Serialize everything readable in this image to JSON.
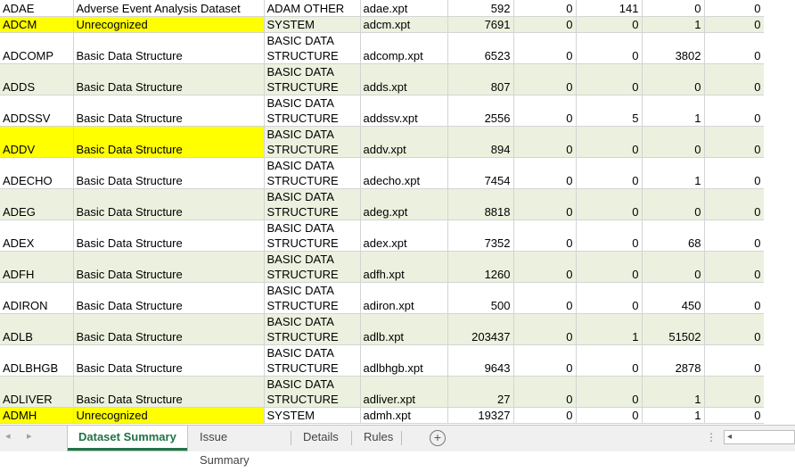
{
  "rows": [
    {
      "code": "ADAE",
      "desc": "Adverse Event Analysis Dataset",
      "type1": "",
      "type2": "ADAM OTHER",
      "file": "adae.xpt",
      "n1": "592",
      "n2": "0",
      "n3": "141",
      "n4": "0",
      "n5": "0",
      "highlight": false,
      "shade": false,
      "tall": false
    },
    {
      "code": "ADCM",
      "desc": "Unrecognized",
      "type1": "",
      "type2": "SYSTEM",
      "file": "adcm.xpt",
      "n1": "7691",
      "n2": "0",
      "n3": "0",
      "n4": "1",
      "n5": "0",
      "highlight": true,
      "shade": true,
      "tall": false
    },
    {
      "code": "ADCOMP",
      "desc": "Basic Data Structure",
      "type1": "BASIC DATA",
      "type2": "STRUCTURE",
      "file": "adcomp.xpt",
      "n1": "6523",
      "n2": "0",
      "n3": "0",
      "n4": "3802",
      "n5": "0",
      "highlight": false,
      "shade": false,
      "tall": true
    },
    {
      "code": "ADDS",
      "desc": "Basic Data Structure",
      "type1": "BASIC DATA",
      "type2": "STRUCTURE",
      "file": "adds.xpt",
      "n1": "807",
      "n2": "0",
      "n3": "0",
      "n4": "0",
      "n5": "0",
      "highlight": false,
      "shade": true,
      "tall": true
    },
    {
      "code": "ADDSSV",
      "desc": "Basic Data Structure",
      "type1": "BASIC DATA",
      "type2": "STRUCTURE",
      "file": "addssv.xpt",
      "n1": "2556",
      "n2": "0",
      "n3": "5",
      "n4": "1",
      "n5": "0",
      "highlight": false,
      "shade": false,
      "tall": true
    },
    {
      "code": "ADDV",
      "desc": "Basic Data Structure",
      "type1": "BASIC DATA",
      "type2": "STRUCTURE",
      "file": "addv.xpt",
      "n1": "894",
      "n2": "0",
      "n3": "0",
      "n4": "0",
      "n5": "0",
      "highlight": true,
      "shade": true,
      "tall": true
    },
    {
      "code": "ADECHO",
      "desc": "Basic Data Structure",
      "type1": "BASIC DATA",
      "type2": "STRUCTURE",
      "file": "adecho.xpt",
      "n1": "7454",
      "n2": "0",
      "n3": "0",
      "n4": "1",
      "n5": "0",
      "highlight": false,
      "shade": false,
      "tall": true
    },
    {
      "code": "ADEG",
      "desc": "Basic Data Structure",
      "type1": "BASIC DATA",
      "type2": "STRUCTURE",
      "file": "adeg.xpt",
      "n1": "8818",
      "n2": "0",
      "n3": "0",
      "n4": "0",
      "n5": "0",
      "highlight": false,
      "shade": true,
      "tall": true
    },
    {
      "code": "ADEX",
      "desc": "Basic Data Structure",
      "type1": "BASIC DATA",
      "type2": "STRUCTURE",
      "file": "adex.xpt",
      "n1": "7352",
      "n2": "0",
      "n3": "0",
      "n4": "68",
      "n5": "0",
      "highlight": false,
      "shade": false,
      "tall": true
    },
    {
      "code": "ADFH",
      "desc": "Basic Data Structure",
      "type1": "BASIC DATA",
      "type2": "STRUCTURE",
      "file": "adfh.xpt",
      "n1": "1260",
      "n2": "0",
      "n3": "0",
      "n4": "0",
      "n5": "0",
      "highlight": false,
      "shade": true,
      "tall": true
    },
    {
      "code": "ADIRON",
      "desc": "Basic Data Structure",
      "type1": "BASIC DATA",
      "type2": "STRUCTURE",
      "file": "adiron.xpt",
      "n1": "500",
      "n2": "0",
      "n3": "0",
      "n4": "450",
      "n5": "0",
      "highlight": false,
      "shade": false,
      "tall": true
    },
    {
      "code": "ADLB",
      "desc": "Basic Data Structure",
      "type1": "BASIC DATA",
      "type2": "STRUCTURE",
      "file": "adlb.xpt",
      "n1": "203437",
      "n2": "0",
      "n3": "1",
      "n4": "51502",
      "n5": "0",
      "highlight": false,
      "shade": true,
      "tall": true
    },
    {
      "code": "ADLBHGB",
      "desc": "Basic Data Structure",
      "type1": "BASIC DATA",
      "type2": "STRUCTURE",
      "file": "adlbhgb.xpt",
      "n1": "9643",
      "n2": "0",
      "n3": "0",
      "n4": "2878",
      "n5": "0",
      "highlight": false,
      "shade": false,
      "tall": true
    },
    {
      "code": "ADLIVER",
      "desc": "Basic Data Structure",
      "type1": "BASIC DATA",
      "type2": "STRUCTURE",
      "file": "adliver.xpt",
      "n1": "27",
      "n2": "0",
      "n3": "0",
      "n4": "1",
      "n5": "0",
      "highlight": false,
      "shade": true,
      "tall": true
    },
    {
      "code": "ADMH",
      "desc": "Unrecognized",
      "type1": "",
      "type2": "SYSTEM",
      "file": "admh.xpt",
      "n1": "19327",
      "n2": "0",
      "n3": "0",
      "n4": "1",
      "n5": "0",
      "highlight": true,
      "shade": false,
      "tall": false
    }
  ],
  "tabs": [
    {
      "label": "Dataset Summary",
      "active": true
    },
    {
      "label": "Issue Summary",
      "active": false
    },
    {
      "label": "Details",
      "active": false
    },
    {
      "label": "Rules",
      "active": false
    }
  ],
  "nav": {
    "prev": "◂",
    "next": "▸",
    "add": "+",
    "more": "⋮",
    "scroll_left": "◂"
  },
  "colors": {
    "highlight": "#ffff00",
    "shade": "#ebf1de",
    "accent": "#217346"
  }
}
